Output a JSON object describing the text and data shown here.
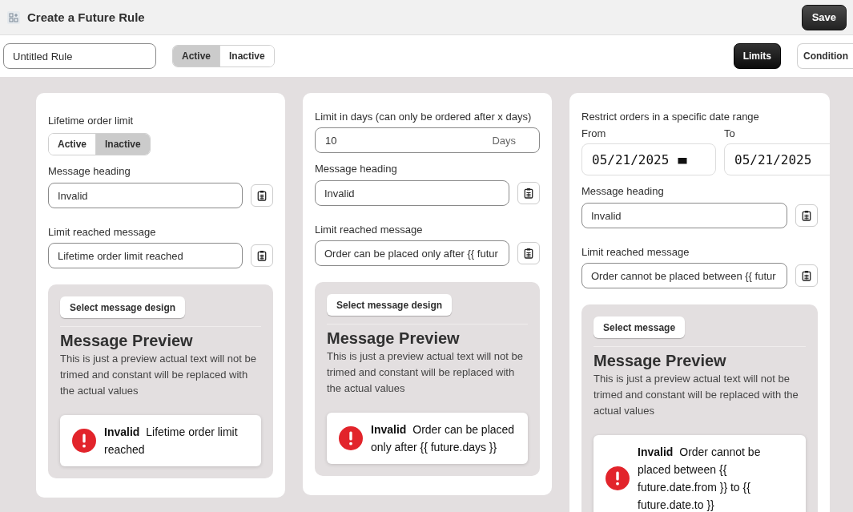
{
  "header": {
    "title": "Create a Future Rule",
    "save_button": "Save"
  },
  "toolbar": {
    "rule_name": "Untitled Rule",
    "status_options": [
      {
        "label": "Active",
        "selected": true
      },
      {
        "label": "Inactive",
        "selected": false
      }
    ],
    "tabs": [
      {
        "label": "Limits",
        "selected": true
      },
      {
        "label": "Condition",
        "selected": false
      }
    ]
  },
  "cards": [
    {
      "kind": "toggle",
      "title": "Lifetime order limit",
      "options": [
        {
          "label": "Active",
          "selected": false
        },
        {
          "label": "Inactive",
          "selected": true
        }
      ],
      "heading_label": "Message heading",
      "heading_value": "Invalid",
      "message_label": "Limit reached message",
      "message_value": "Lifetime order limit reached",
      "design_button": "Select message design",
      "preview_title": "Message Preview",
      "preview_text": "This is just a preview actual text will not be trimed and constant will be replaced with the actual values",
      "notice": "**Invalid** Lifetime order limit reached"
    },
    {
      "kind": "days",
      "title": "Limit in days (can only be ordered after x days)",
      "days_value": "10",
      "days_unit": "Days",
      "heading_label": "Message heading",
      "heading_value": "Invalid",
      "message_label": "Limit reached message",
      "message_value": "Order can be placed only after {{ futur",
      "design_button": "Select message design",
      "preview_title": "Message Preview",
      "preview_text": "This is just a preview actual text will not be trimed and constant will be replaced with the actual values",
      "notice": "**Invalid** Order can be placed only after {{ future.days }}"
    },
    {
      "kind": "daterange",
      "title": "Restrict orders in a specific date range",
      "dates": [
        {
          "label": "From",
          "value": "05/21/2025",
          "picker_icon": true
        },
        {
          "label": "To",
          "value": "05/21/2025",
          "picker_icon": false
        }
      ],
      "heading_label": "Message heading",
      "heading_value": "Invalid",
      "message_label": "Limit reached message",
      "message_value": "Order cannot be placed between {{ futur",
      "design_button": "Select message",
      "preview_title": "Message Preview",
      "preview_text": "This is just a preview actual text will not be trimed and constant will be replaced with the actual values",
      "notice": "**Invalid** Order cannot be placed between {{ future.date.from }} to {{ future.date.to }}"
    }
  ]
}
